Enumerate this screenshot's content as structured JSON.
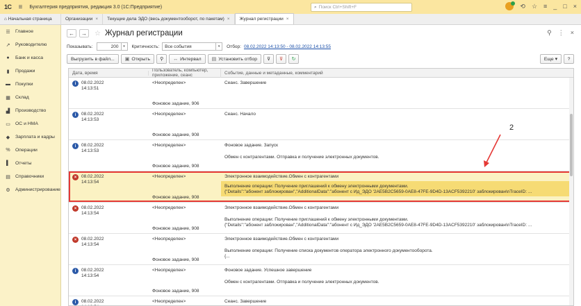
{
  "app": {
    "logo": "1С",
    "title": "Бухгалтерия предприятия, редакция 3.0 (1С:Предприятие)",
    "search_placeholder": "Поиск Ctrl+Shift+F"
  },
  "tabs": [
    {
      "label": "Начальная страница"
    },
    {
      "label": "Организации"
    },
    {
      "label": "Текущие дела ЭДО (весь документооборот, по пакетам)"
    },
    {
      "label": "Журнал регистрации"
    }
  ],
  "sidebar": {
    "items": [
      {
        "label": "Главное",
        "icon": "☰"
      },
      {
        "label": "Руководителю",
        "icon": "↗"
      },
      {
        "label": "Банк и касса",
        "icon": "●"
      },
      {
        "label": "Продажи",
        "icon": "▮"
      },
      {
        "label": "Покупки",
        "icon": "▬"
      },
      {
        "label": "Склад",
        "icon": "▦"
      },
      {
        "label": "Производство",
        "icon": "▟"
      },
      {
        "label": "ОС и НМА",
        "icon": "▭"
      },
      {
        "label": "Зарплата и кадры",
        "icon": "◆"
      },
      {
        "label": "Операции",
        "icon": "%"
      },
      {
        "label": "Отчеты",
        "icon": "▌"
      },
      {
        "label": "Справочники",
        "icon": "▤"
      },
      {
        "label": "Администрирование",
        "icon": "⚙"
      }
    ]
  },
  "page": {
    "title": "Журнал регистрации"
  },
  "filters": {
    "show_label": "Показывать:",
    "show_value": "200",
    "criticality_label": "Критичность:",
    "criticality_value": "Все события",
    "selection_label": "Отбор:",
    "selection_value": "08.02.2022 14:13:50 - 08.02.2022 14:13:55"
  },
  "toolbar": {
    "export": "Выгрузить в файл...",
    "open": "Открыть",
    "interval": "Интервал",
    "set_filter": "Установить отбор",
    "more": "Еще",
    "help": "?"
  },
  "table": {
    "headers": [
      "Дата, время",
      "Пользователь, компьютер, приложение, сеанс",
      "Событие, данные и метаданные, комментарий"
    ],
    "rows": [
      {
        "level": "info",
        "date": "08.02.2022",
        "time": "14:13:51",
        "user": "<Неопределен>",
        "app": "Фоновое задание, 906",
        "event": "Сеанс. Завершение",
        "details": ""
      },
      {
        "level": "info",
        "date": "08.02.2022",
        "time": "14:13:53",
        "user": "<Неопределен>",
        "app": "Фоновое задание, 908",
        "event": "Сеанс. Начало",
        "details": ""
      },
      {
        "level": "info",
        "date": "08.02.2022",
        "time": "14:13:53",
        "user": "<Неопределен>",
        "app": "Фоновое задание, 908",
        "event": "Фоновое задание. Запуск",
        "details": "Обмен с контрагентами. Отправка и получение электронных документов."
      },
      {
        "level": "err",
        "date": "08.02.2022",
        "time": "14:13:54",
        "user": "<Неопределен>",
        "app": "Фоновое задание, 908",
        "event": "Электронное взаимодействие.Обмен с контрагентами",
        "details": "Выполнение операции: Получение приглашений к обмену электронными документами.",
        "details2": "{\"Details\":\"абонент заблокирован\",\"AdditionalData\":\"абонент с Ид_ЭДО '2AE5B2C5659-0AE8-47FE-9D4D-13ACF5392210' заблокирован\\nTraceID: ..."
      },
      {
        "level": "err",
        "date": "08.02.2022",
        "time": "14:13:54",
        "user": "<Неопределен>",
        "app": "Фоновое задание, 908",
        "event": "Электронное взаимодействие.Обмен с контрагентами",
        "details": "Выполнение операции: Получение приглашений к обмену электронными документами.",
        "details2": "{\"Details\":\"абонент заблокирован\",\"AdditionalData\":\"абонент с Ид_ЭДО '2AE5B2C5659-0AE8-47FE-9D4D-13ACF5392210' заблокирован\\nTraceID: ..."
      },
      {
        "level": "err",
        "date": "08.02.2022",
        "time": "14:13:54",
        "user": "<Неопределен>",
        "app": "Фоновое задание, 908",
        "event": "Электронное взаимодействие.Обмен с контрагентами",
        "details": "Выполнение операции: Получение списка документов оператора электронного документооборота.",
        "details2": "{..."
      },
      {
        "level": "info",
        "date": "08.02.2022",
        "time": "14:13:54",
        "user": "<Неопределен>",
        "app": "Фоновое задание, 908",
        "event": "Фоновое задание. Успешное завершение",
        "details": "Обмен с контрагентами. Отправка и получение электронных документов."
      },
      {
        "level": "info",
        "date": "08.02.2022",
        "time": "14:13:54",
        "user": "<Неопределен>",
        "app": "",
        "event": "Сеанс. Завершение",
        "details": ""
      }
    ]
  },
  "annotation": {
    "number": "2"
  }
}
